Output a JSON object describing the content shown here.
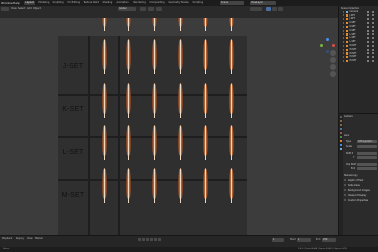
{
  "menu": [
    "Window",
    "Help"
  ],
  "workspace_tabs": [
    {
      "label": "Layout",
      "active": true
    },
    {
      "label": "Modeling",
      "active": false
    },
    {
      "label": "Sculpting",
      "active": false
    },
    {
      "label": "UV Editing",
      "active": false
    },
    {
      "label": "Texture Paint",
      "active": false
    },
    {
      "label": "Shading",
      "active": false
    },
    {
      "label": "Animation",
      "active": false
    },
    {
      "label": "Rendering",
      "active": false
    },
    {
      "label": "Compositing",
      "active": false
    },
    {
      "label": "Geometry Nodes",
      "active": false
    },
    {
      "label": "Scripting",
      "active": false
    }
  ],
  "topbar_right": {
    "scene_label": "Scene",
    "view_layer_label": "ViewLayer"
  },
  "viewport_header": {
    "mode_menu": [
      "View",
      "Select",
      "Add",
      "Object"
    ],
    "transform_orientation": "Global",
    "shading_modes": [
      "wireframe",
      "solid",
      "material",
      "rendered"
    ]
  },
  "set_labels": [
    "J-SET",
    "K-SET",
    "L-SET",
    "M-SET"
  ],
  "outliner": {
    "title": "Scene Collection",
    "rows": [
      {
        "label": "Camera",
        "icon": "camera-icon",
        "color": "#7fb3d5"
      },
      {
        "label": "J-SET",
        "icon": "object-icon",
        "color": "#e88a2e"
      },
      {
        "label": "J-SET",
        "icon": "object-icon",
        "color": "#e88a2e"
      },
      {
        "label": "K-SET",
        "icon": "object-icon",
        "color": "#e88a2e"
      },
      {
        "label": "K-SET",
        "icon": "object-icon",
        "color": "#e88a2e"
      },
      {
        "label": "K-SET",
        "icon": "object-icon",
        "color": "#e88a2e"
      },
      {
        "label": "L-SET",
        "icon": "object-icon",
        "color": "#e88a2e"
      },
      {
        "label": "L-SET",
        "icon": "object-icon",
        "color": "#e88a2e"
      },
      {
        "label": "L-SET",
        "icon": "object-icon",
        "color": "#e88a2e"
      },
      {
        "label": "M-SET",
        "icon": "object-icon",
        "color": "#e88a2e"
      },
      {
        "label": "M-SET",
        "icon": "object-icon",
        "color": "#e88a2e"
      },
      {
        "label": "M-SET",
        "icon": "object-icon",
        "color": "#e88a2e"
      },
      {
        "label": "M-SET",
        "icon": "object-icon",
        "color": "#e88a2e"
      },
      {
        "label": "M-SET",
        "icon": "object-icon",
        "color": "#e88a2e"
      }
    ]
  },
  "properties": {
    "object_name": "Camera",
    "section_lens": "Lens",
    "type_label": "Type",
    "type_value": "Orthographic",
    "scale_label": "Scale",
    "shift_x": "Shift X",
    "shift_y": "Y",
    "clip_start": "Clip Start",
    "clip_end": "End",
    "stereoscopy": "Stereoscopy",
    "checkboxes": [
      "Depth of Field",
      "Safe Areas",
      "Background Images",
      "Viewport Display",
      "Custom Properties"
    ]
  },
  "timeline": {
    "menus": [
      "Playback",
      "Keying",
      "View",
      "Marker"
    ],
    "current_frame": "1",
    "start_label": "Start",
    "start_value": "1",
    "end_label": "End",
    "end_value": "250"
  },
  "statusbar": {
    "left": "Select",
    "right": "3.6.0  |  Verts 4,664  |  Faces 4,560  |  Objects 0/16"
  },
  "colors": {
    "accent": "#e88a2e",
    "gizmo_x": "#e04b4b",
    "gizmo_y": "#79b33d",
    "gizmo_z": "#4a8ef0"
  }
}
